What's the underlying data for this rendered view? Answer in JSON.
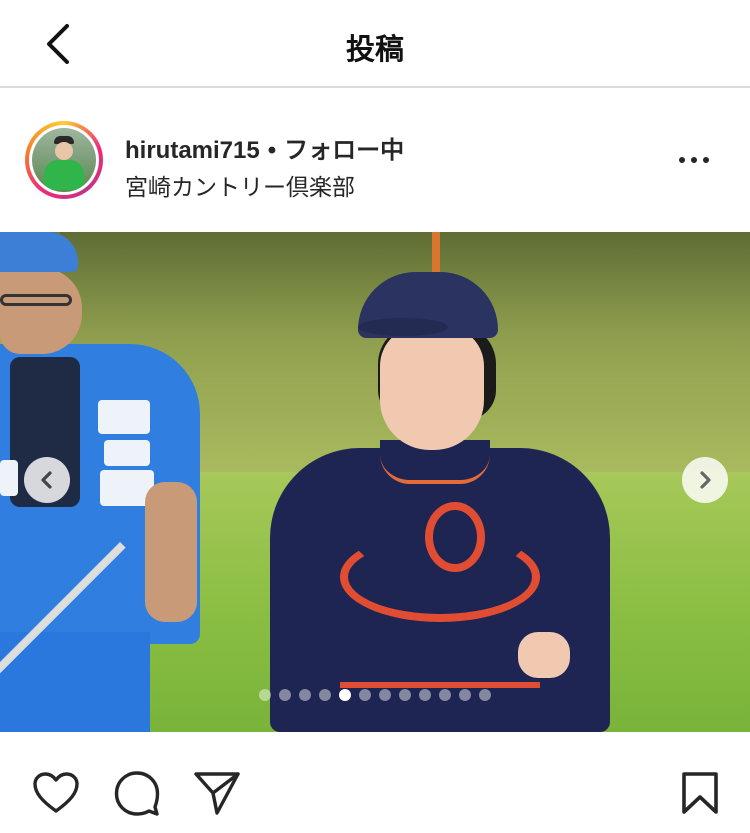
{
  "header": {
    "title": "投稿"
  },
  "post": {
    "username": "hirutami715",
    "separator": "•",
    "follow_status": "フォロー中",
    "location": "宮崎カントリー倶楽部"
  },
  "carousel": {
    "total_slides": 12,
    "active_slide": 5
  },
  "icons": {
    "back": "chevron-left-icon",
    "more": "more-options-icon",
    "prev": "chevron-left-icon",
    "next": "chevron-right-icon",
    "like": "heart-icon",
    "comment": "comment-bubble-icon",
    "share": "paper-plane-icon",
    "save": "bookmark-icon"
  },
  "colors": {
    "text": "#262626",
    "divider": "#dbdbdb",
    "story_ring_start": "#f9ce34",
    "story_ring_mid": "#ee2a7b",
    "story_ring_end": "#c13584"
  }
}
